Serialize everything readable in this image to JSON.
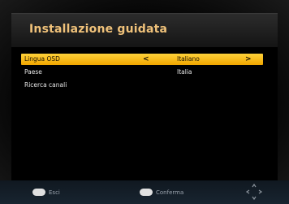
{
  "header": {
    "title": "Installazione guidata"
  },
  "menu": {
    "items": [
      {
        "label": "Lingua OSD",
        "value": "Italiano",
        "selected": true
      },
      {
        "label": "Paese",
        "value": "Italia",
        "selected": false
      },
      {
        "label": "Ricerca canali",
        "value": "",
        "selected": false
      }
    ],
    "arrow_left": "<",
    "arrow_right": ">"
  },
  "footer": {
    "exit_label": "Esci",
    "exit_icon": "exit-button-icon",
    "confirm_label": "Conferma",
    "confirm_icon": "ok-button-icon",
    "nav_icon": "navigation-arrows-icon"
  },
  "colors": {
    "title": "#f0c27a",
    "selection": "#f1a600",
    "footer": "#182430"
  }
}
